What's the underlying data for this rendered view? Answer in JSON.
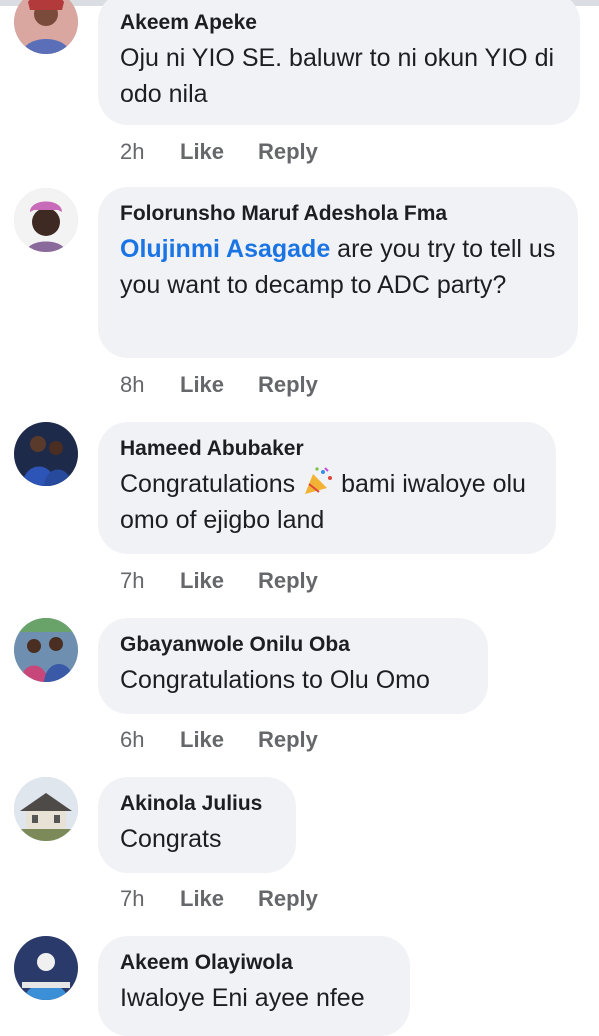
{
  "comments": [
    {
      "author": "Akeem Apeke",
      "text": "Oju ni YIO SE. baluwr to ni okun YIO di odo nila",
      "time": "2h",
      "avatar_icon": "person-avatar-icon"
    },
    {
      "author": "Folorunsho Maruf Adeshola Fma",
      "mention": "Olujinmi Asagade",
      "text": " are you try to tell us you want to decamp to ADC party?",
      "time": "8h",
      "avatar_icon": "person-avatar-icon"
    },
    {
      "author": "Hameed Abubaker",
      "text_before": "Congratulations",
      "emoji": "party-popper-icon",
      "text_after": "bami iwaloye olu omo of ejigbo land",
      "time": "7h",
      "avatar_icon": "person-avatar-icon"
    },
    {
      "author": "Gbayanwole Onilu Oba",
      "text": "Congratulations to Olu Omo",
      "time": "6h",
      "avatar_icon": "person-avatar-icon"
    },
    {
      "author": "Akinola Julius",
      "text": "Congrats",
      "time": "7h",
      "avatar_icon": "house-avatar-icon"
    },
    {
      "author": "Akeem Olayiwola",
      "text": "Iwaloye Eni ayee nfee",
      "avatar_icon": "person-avatar-icon"
    }
  ],
  "actions": {
    "like_label": "Like",
    "reply_label": "Reply"
  },
  "colors": {
    "bubble": "#f0f2f5",
    "mention": "#1b74e4",
    "meta": "#65676b",
    "text": "#1c1e21"
  }
}
